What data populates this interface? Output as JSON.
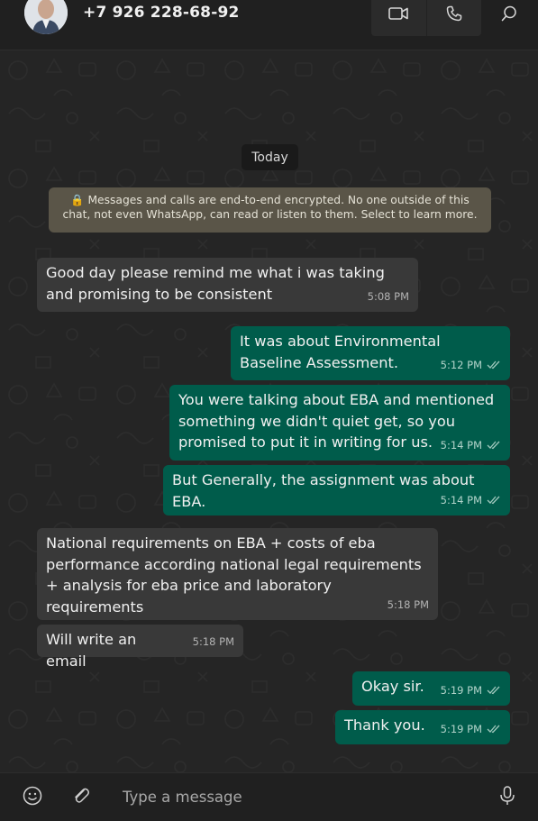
{
  "header": {
    "contact_name": "+7 926 228-68-92",
    "icons": [
      "avatar",
      "video-call-icon",
      "voice-call-icon",
      "search-icon"
    ]
  },
  "chat": {
    "date_label": "Today",
    "encryption_notice": "🔒 Messages and calls are end-to-end encrypted. No one outside of this chat, not even WhatsApp, can read or listen to them. Select to learn more.",
    "messages": [
      {
        "direction": "in",
        "text": "Good day please remind me what i was taking and promising to be consistent",
        "time": "5:08 PM"
      },
      {
        "direction": "out",
        "text": "It was about Environmental Baseline Assessment.",
        "time": "5:12 PM"
      },
      {
        "direction": "out",
        "text": "You were talking about EBA and mentioned something we didn't quiet get, so you promised to put it in writing for us.",
        "time": "5:14 PM"
      },
      {
        "direction": "out",
        "text": "But Generally, the assignment was about EBA.",
        "time": "5:14 PM"
      },
      {
        "direction": "in",
        "text": "National requirements on EBA + costs of eba performance according national legal requirements + analysis for eba  price and laboratory requirements",
        "time": "5:18 PM"
      },
      {
        "direction": "in",
        "text": "Will write an email",
        "time": "5:18 PM"
      },
      {
        "direction": "out",
        "text": "Okay sir.",
        "time": "5:19 PM"
      },
      {
        "direction": "out",
        "text": "Thank you.",
        "time": "5:19 PM"
      }
    ]
  },
  "composer": {
    "placeholder": "Type a message",
    "icons": [
      "emoji-icon",
      "attach-icon",
      "microphone-icon"
    ]
  },
  "colors": {
    "incoming_bubble": "#393939",
    "outgoing_bubble": "#005c4b",
    "background": "#252525"
  }
}
